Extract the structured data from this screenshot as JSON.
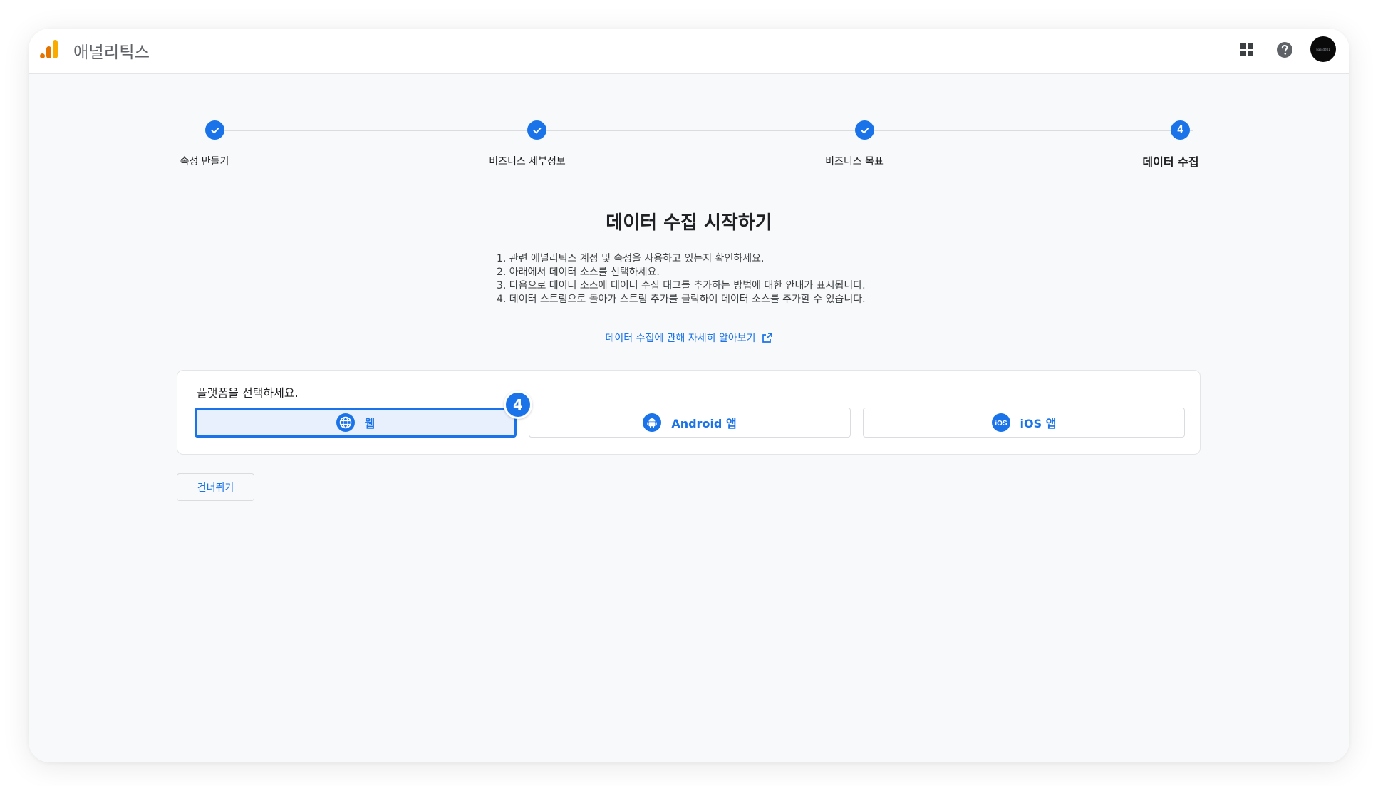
{
  "app": {
    "title": "애널리틱스",
    "avatar_text": "bassdd01"
  },
  "header_icons": [
    "grid-apps-icon",
    "help-icon"
  ],
  "stepper": {
    "steps": [
      {
        "label": "속성 만들기",
        "state": "done"
      },
      {
        "label": "비즈니스 세부정보",
        "state": "done"
      },
      {
        "label": "비즈니스 목표",
        "state": "done"
      },
      {
        "label": "데이터 수집",
        "state": "current",
        "number": "4"
      }
    ]
  },
  "main": {
    "title": "데이터 수집 시작하기",
    "instructions": [
      "1. 관련 애널리틱스 계정 및 속성을 사용하고 있는지 확인하세요.",
      "2. 아래에서 데이터 소스를 선택하세요.",
      "3. 다음으로 데이터 소스에 데이터 수집 태그를 추가하는 방법에 대한 안내가 표시됩니다.",
      "4. 데이터 스트림으로 돌아가 스트림 추가를 클릭하여 데이터 소스를 추가할 수 있습니다."
    ],
    "learn_more": "데이터 수집에 관해 자세히 알아보기"
  },
  "platform": {
    "prompt": "플랫폼을 선택하세요.",
    "options": [
      {
        "label": "웹",
        "icon": "globe-icon",
        "selected": true
      },
      {
        "label": "Android 앱",
        "icon": "android-icon",
        "selected": false
      },
      {
        "label": "iOS 앱",
        "icon": "ios-icon",
        "selected": false
      }
    ],
    "badge": "4"
  },
  "skip_label": "건너뛰기",
  "colors": {
    "accent": "#1a73e8",
    "logo_orange": "#f9ab00",
    "logo_dark_orange": "#e37400"
  }
}
